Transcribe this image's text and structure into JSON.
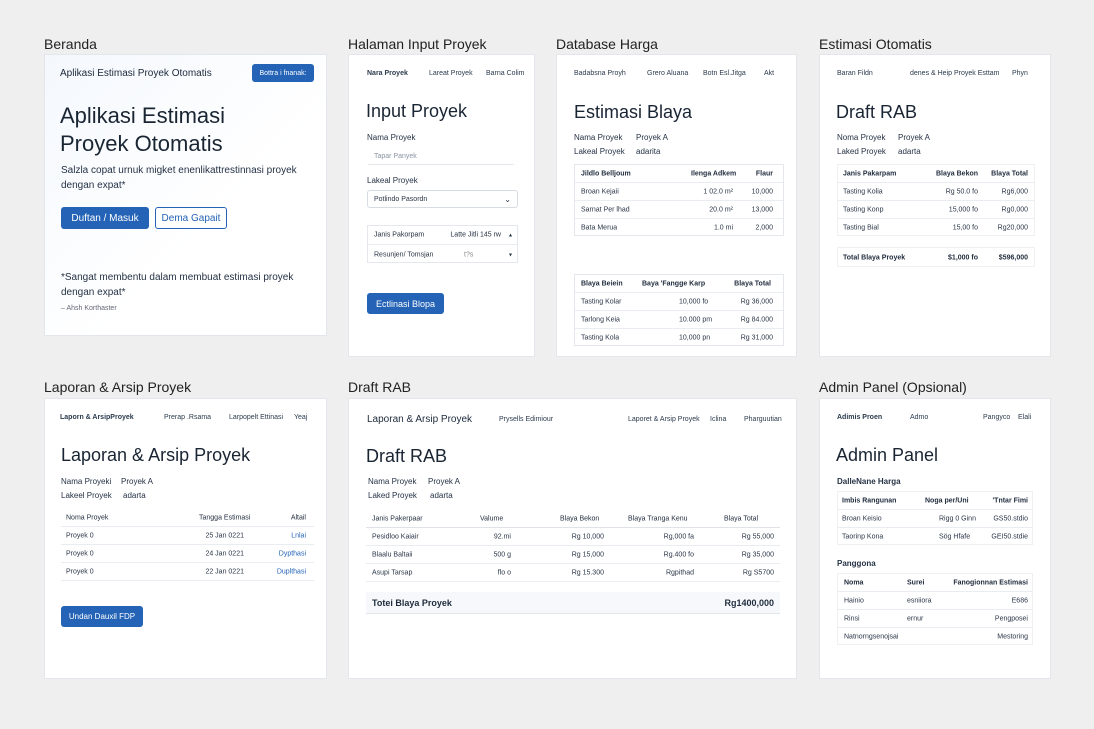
{
  "labels": {
    "beranda": "Beranda",
    "input": "Halaman Input Proyek",
    "database": "Database Harga",
    "estimasi": "Estimasi Otomatis",
    "laporan": "Laporan & Arsip Proyek",
    "draft": "Draft RAB",
    "admin": "Admin Panel (Opsional)"
  },
  "beranda": {
    "nav_title": "Aplikasi Estimasi Proyek Otomatis",
    "nav_button": "Bottra i fnanak:",
    "hero_line1": "Aplikasi Estimasi",
    "hero_line2": "Proyek Otomatis",
    "desc_line1": "Salzla copat urnuk migket enenlikattrestinnasi proyek",
    "desc_line2": "dengan expat*",
    "primary_button": "Duftan / Masuk",
    "secondary_button": "Dema Gapait",
    "quote_line1": "*Sangat membentu dalam membuat estimasi proyek",
    "quote_line2": "dengan expat*",
    "quote_author": "– Ahsh Korthaster"
  },
  "input": {
    "nav": [
      "Nara Proyek",
      "Lareat Proyek",
      "Barna Colim"
    ],
    "title": "Input Proyek",
    "name_label": "Nama Proyek",
    "name_placeholder": "Tapar Panyek",
    "location_label": "Lakeal Proyek",
    "location_value": "Potlindo Pasordn",
    "table_header_left": "Janis Pakorpam",
    "table_header_right": "Latte Jitli 145 rw",
    "table_row_left": "Resunjen/ Tomsjan",
    "table_row_mid": "t?s",
    "button": "Ectlinasi Blopa"
  },
  "database": {
    "nav": [
      "Badabsna Proyh",
      "Grero Aluana",
      "Botn Esl.Jitga",
      "Akt"
    ],
    "title": "Estimasi Blaya",
    "meta": [
      [
        "Nama Proyek",
        "Proyek A"
      ],
      [
        "Lakeal Proyek",
        "adarita"
      ]
    ],
    "table1": {
      "headers": [
        "Jildlo Belljoum",
        "Ilenga Adkem",
        "Flaur"
      ],
      "rows": [
        [
          "Broan Kejaii",
          "1 02.0 m²",
          "10,000"
        ],
        [
          "Sarnat Per lhad",
          "20.0 m²",
          "13,000"
        ],
        [
          "Bata Merua",
          "1.0 mi",
          "2,000"
        ]
      ]
    },
    "table2": {
      "headers": [
        "Blaya Beiein",
        "Baya 'Fangge Karp",
        "Blaya Total"
      ],
      "rows": [
        [
          "Tasting Kolar",
          "10,000 fo",
          "Rg 36,000"
        ],
        [
          "Tarlong Keia",
          "10.000 pm",
          "Rg 84.000"
        ],
        [
          "Tasting Kola",
          "10,000 pn",
          "Rg 31,000"
        ]
      ]
    }
  },
  "estimasi": {
    "nav": [
      "Baran Fildn",
      "denes & Heip Proyek Esttam",
      "Phyn"
    ],
    "title": "Draft RAB",
    "meta": [
      [
        "Noma Proyek",
        "Proyek A"
      ],
      [
        "Laked Proyek",
        "adarta"
      ]
    ],
    "headers": [
      "Janis Pakarpam",
      "Blaya Bekon",
      "Blaya Total"
    ],
    "rows": [
      [
        "Tasting Kolia",
        "Rg 50.0 fo",
        "Rg6,000"
      ],
      [
        "Tasting Konp",
        "15,000 fo",
        "Rg0,000"
      ],
      [
        "Tasting Bial",
        "15,00 fo",
        "Rg20,000"
      ]
    ],
    "total": [
      "Total Blaya Proyek",
      "$1,000 fo",
      "$596,000"
    ]
  },
  "laporan": {
    "nav": [
      "Laporn & ArsipProyek",
      "Prerap .Rsama",
      "Larpopelt Ettinasi",
      "Yeaj"
    ],
    "title": "Laporan & Arsip Proyek",
    "meta": [
      [
        "Nama Proyeki",
        "Proyek A"
      ],
      [
        "Lakeel Proyek",
        "adarta"
      ]
    ],
    "headers": [
      "Noma Proyek",
      "Tangga Estimasi",
      "Altail"
    ],
    "rows": [
      [
        "Proyek 0",
        "25 Jan 0221",
        "Lnlai"
      ],
      [
        "Proyek 0",
        "24 Jan 0221",
        "Dypthasi"
      ],
      [
        "Proyek 0",
        "22 Jan 0221",
        "Duplthasi"
      ]
    ],
    "button": "Undan Dauxil FDP"
  },
  "draft": {
    "nav": [
      "Laporan & Arsip Proyek",
      "Prysells Edimiour",
      "Laporet & Arsip Proyek",
      "Iclina",
      "Pharguutian"
    ],
    "title": "Draft RAB",
    "meta": [
      [
        "Nama Proyek",
        "Proyek A"
      ],
      [
        "Laked Proyek",
        "adarta"
      ]
    ],
    "headers": [
      "Janis Pakerpaar",
      "Valume",
      "Blaya Bekon",
      "Blaya Tranga Kenu",
      "Blaya Total"
    ],
    "rows": [
      [
        "Pesidloo Kaiair",
        "92.mi",
        "Rg 10,000",
        "Rg,000 fa",
        "Rg 55,000"
      ],
      [
        "Blaalu Baltaii",
        "500 g",
        "Rg 15,000",
        "Rg.400 fo",
        "Rg 35,000"
      ],
      [
        "Asupi Tarsap",
        "flo o",
        "Rg 15.300",
        "Rgpithad",
        "Rg S5700"
      ]
    ],
    "total_label": "Totei Blaya Proyek",
    "total_value": "Rg1400,000"
  },
  "admin": {
    "nav": [
      "Adimis Proen",
      "Admo",
      "Pangyco",
      "Elali"
    ],
    "title": "Admin Panel",
    "sub1": "DalleNane Harga",
    "table1": {
      "headers": [
        "Imbis Rangunan",
        "Noga per/Uni",
        "'Tntar Fimi"
      ],
      "rows": [
        [
          "Broan Keisio",
          "Rigg 0 Ginn",
          "GS50.stdio"
        ],
        [
          "Taorinp Kona",
          "Sög Hfafe",
          "GEI50.stdie"
        ]
      ]
    },
    "sub2": "Panggona",
    "table2": {
      "headers": [
        "Noma",
        "Surei",
        "Fanogionnan Estimasi"
      ],
      "rows": [
        [
          "Hainio",
          "esniiora",
          "E686"
        ],
        [
          "Rinsi",
          "ernur",
          "Pengposei"
        ],
        [
          "Natnorngsenojsai",
          "",
          "Mestoring"
        ]
      ]
    }
  }
}
